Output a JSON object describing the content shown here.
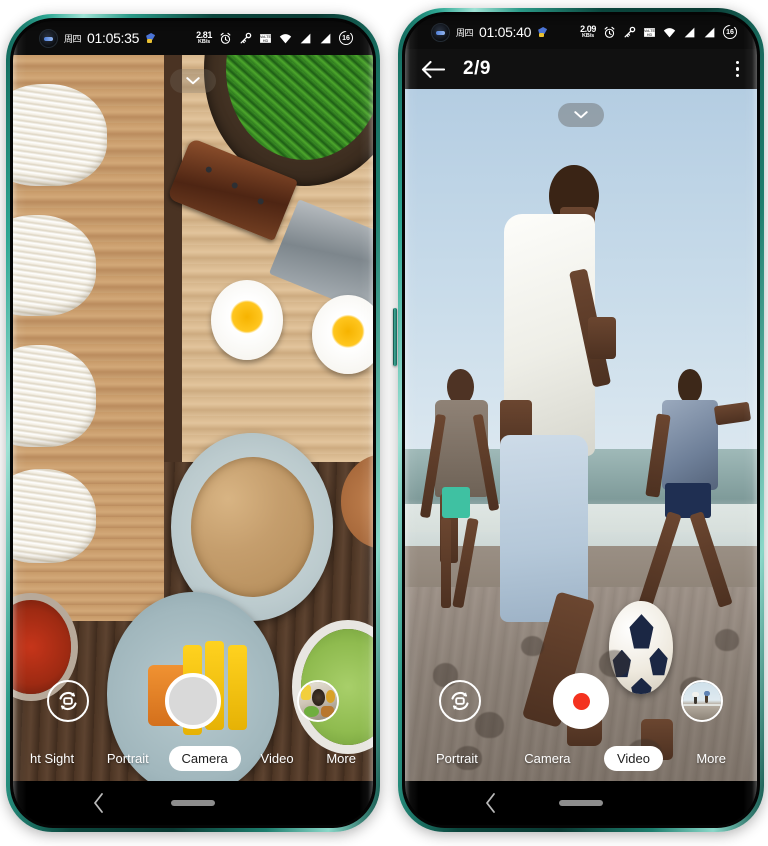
{
  "scene": {
    "description": "Two Android phones side by side showing a camera app",
    "frame_color": "#1d7e6e"
  },
  "phone_left": {
    "status_bar": {
      "day": "周四",
      "time": "01:05:35",
      "net_speed_value": "2.81",
      "net_speed_unit": "KB/s",
      "battery_level": "16",
      "icons": [
        "punch-hole-camera",
        "app-notification-icon",
        "alarm-clock-icon",
        "key-icon",
        "volte-icon",
        "wifi-icon",
        "signal-sim1-icon",
        "signal-sim2-icon",
        "battery-icon"
      ]
    },
    "viewfinder": {
      "subject": "food flat-lay: soba noodles, spinach bowl, knife, boiled eggs, grain plate",
      "collapse_label": "chevron-down"
    },
    "controls": {
      "flip_camera_label": "flip-camera",
      "shutter_label": "shutter",
      "thumbnail_label": "last-photo-thumbnail"
    },
    "modes": [
      {
        "label": "ht Sight",
        "active": false
      },
      {
        "label": "Portrait",
        "active": false
      },
      {
        "label": "Camera",
        "active": true
      },
      {
        "label": "Video",
        "active": false
      },
      {
        "label": "More",
        "active": false
      }
    ],
    "nav_bar": {
      "back_label": "back",
      "home_label": "home"
    }
  },
  "phone_right": {
    "status_bar": {
      "day": "周四",
      "time": "01:05:40",
      "net_speed_value": "2.09",
      "net_speed_unit": "KB/s",
      "battery_level": "16",
      "icons": [
        "punch-hole-camera",
        "app-notification-icon",
        "alarm-clock-icon",
        "key-icon",
        "volte-icon",
        "wifi-icon",
        "signal-sim1-icon",
        "signal-sim2-icon",
        "battery-icon"
      ]
    },
    "app_bar": {
      "back_label": "back-arrow",
      "title": "2/9",
      "menu_label": "more-options"
    },
    "viewfinder": {
      "subject": "beach soccer: three men playing football on sand by the sea",
      "collapse_label": "chevron-down"
    },
    "controls": {
      "flip_camera_label": "flip-camera",
      "shutter_label": "record",
      "record_dot_color": "#f4321f",
      "thumbnail_label": "last-photo-thumbnail"
    },
    "modes": [
      {
        "label": "Portrait",
        "active": false
      },
      {
        "label": "Camera",
        "active": false
      },
      {
        "label": "Video",
        "active": true
      },
      {
        "label": "More",
        "active": false
      }
    ],
    "nav_bar": {
      "back_label": "back",
      "home_label": "home"
    }
  }
}
